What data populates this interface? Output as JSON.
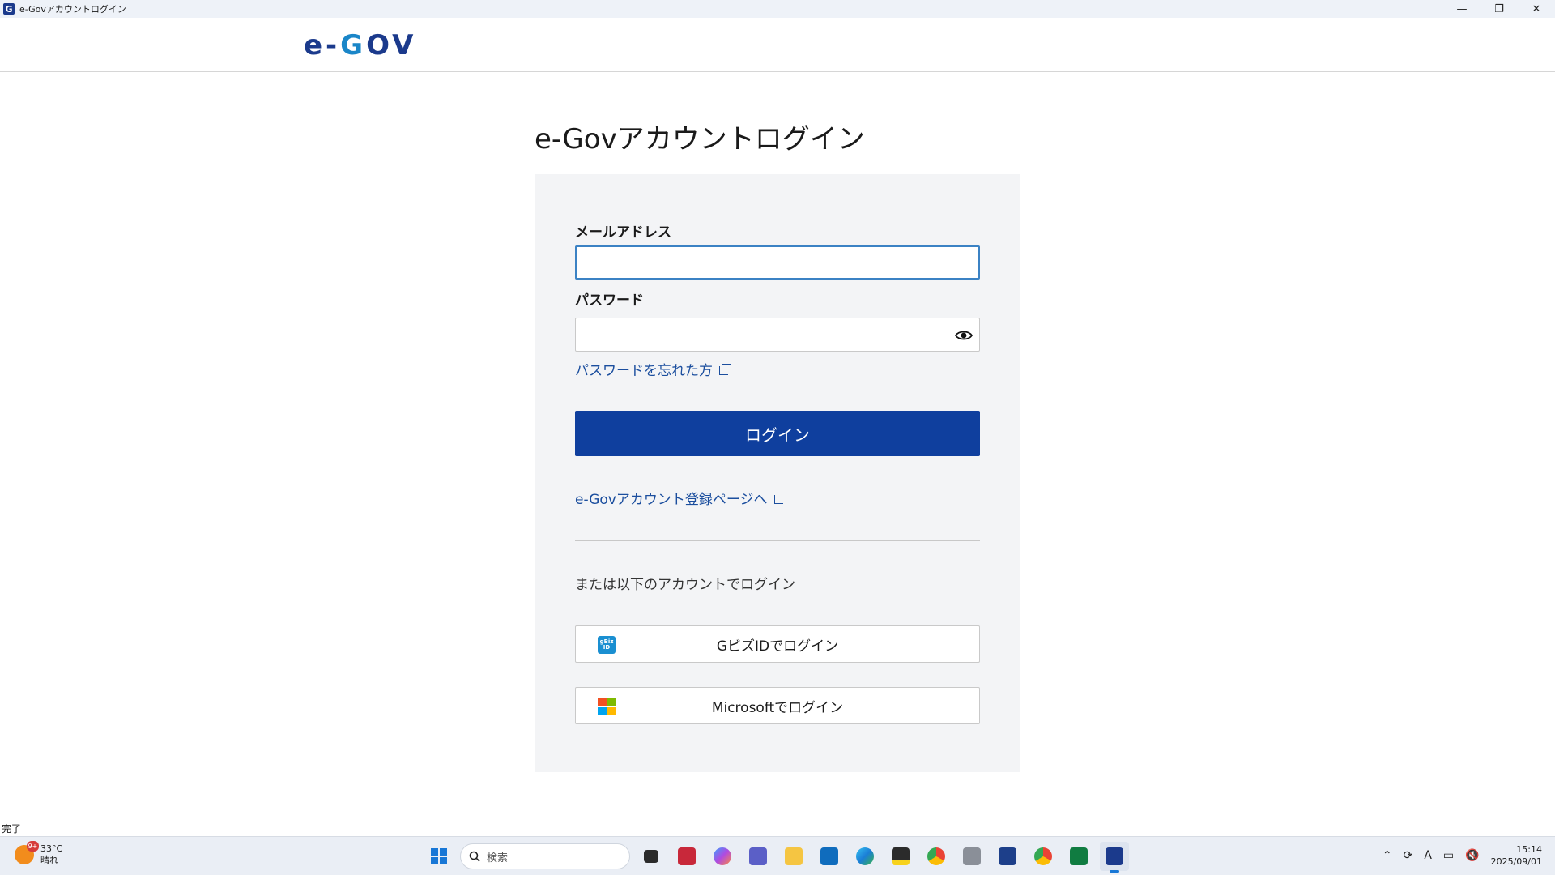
{
  "window": {
    "title": "e-Govアカウントログイン",
    "app_icon": "G",
    "minimize": "—",
    "restore": "❐",
    "close": "✕"
  },
  "header": {
    "logo_left": "e-",
    "logo_accent": "G",
    "logo_right": "OV"
  },
  "main": {
    "page_title": "e-Govアカウントログイン",
    "email_label": "メールアドレス",
    "email_value": "",
    "password_label": "パスワード",
    "password_value": "",
    "forgot_link": "パスワードを忘れた方",
    "login_button": "ログイン",
    "register_link": "e-Govアカウント登録ページへ",
    "alt_text": "または以下のアカウントでログイン",
    "gbiz_button": "GビズIDでログイン",
    "gbiz_icon_text": "gBiz ID",
    "microsoft_button": "Microsoftでログイン"
  },
  "statusbar": {
    "text": "完了"
  },
  "taskbar": {
    "weather_temp": "33°C",
    "weather_desc": "晴れ",
    "weather_badge": "9+",
    "search_placeholder": "検索",
    "time": "15:14",
    "date": "2025/09/01",
    "ime": "A"
  },
  "colors": {
    "brand_navy": "#0f3f9e",
    "link_blue": "#1b4e9e",
    "focus_blue": "#3b82c4"
  }
}
